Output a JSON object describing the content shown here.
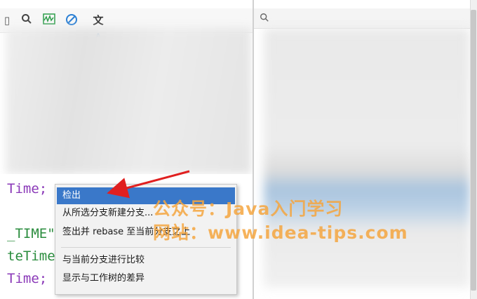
{
  "toolbar": {
    "icons": [
      "search-icon",
      "activity-icon",
      "no-entry-icon",
      "translate-icon"
    ],
    "translate_glyph": "文"
  },
  "code": {
    "lines": [
      "Time;",
      "_TIME\"",
      "teTime",
      "Time;"
    ]
  },
  "context_menu": {
    "items": [
      {
        "label": "检出",
        "selected": true
      },
      {
        "label": "从所选分支新建分支..."
      },
      {
        "label": "签出并 rebase 至当前分支之上"
      },
      {
        "label": "与当前分支进行比较"
      },
      {
        "label": "显示与工作树的差异"
      }
    ]
  },
  "watermark": {
    "line1": "公众号：Java入门学习",
    "line2": "网站：www.idea-tips.com"
  },
  "colors": {
    "menu_highlight": "#3a78c9",
    "watermark": "#f5a640",
    "arrow": "#e02020"
  }
}
